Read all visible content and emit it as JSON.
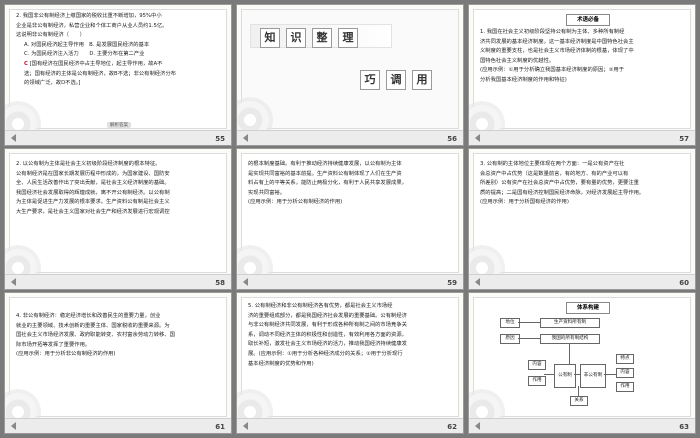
{
  "slides": [
    {
      "number": "55",
      "lines": [
        "2. 我国非公有制经济上缴国家的税收比重不断增加，95%中小",
        "企业是非公有制经济，私营企业和个体工商户从业人员约1.5亿。",
        "这说明非公有制经济（　　）",
        "A. 对国民经济起主导作用　B. 是发展国民经济的基本",
        "C. 为国民经济注入活力　　D. 主要分布在第二产业"
      ],
      "answer_letter": "C",
      "answer_lines": [
        "[国有经济在国民经济中占主导地位，起主导作用，故A不",
        "选；国有经济的主体是公有制经济，故B不选；非公有制经济分布",
        "的领域广泛，故D不选。]"
      ],
      "tag": "解析答案"
    },
    {
      "number": "56",
      "chars_top": [
        "知",
        "识",
        "整",
        "理"
      ],
      "chars_bottom": [
        "巧",
        "调",
        "用"
      ]
    },
    {
      "number": "57",
      "heading": "术语必备",
      "lines": [
        "1. 我国在社会主义初级阶段坚持公有制为主体、多种所有制经",
        "济共同发展的基本经济制度。这一基本经济制度是中国特色社会主",
        "义制度的重要支柱，也是社会主义市场经济体制的根基，体现了中",
        "国特色社会主义制度的优越性。",
        "(应用示例：①用于分析确立我国基本经济制度的原因；②用于",
        "分析我国基本经济制度的作用和特征)"
      ]
    },
    {
      "number": "58",
      "lines": [
        "2. 以公有制为主体是社会主义初级阶段经济制度的根本特征。",
        "公有制经济是在国家长期发展历程中形成的，为国家建设、国防安",
        "全、人民生活改善作出了突出贡献，是社会主义经济制度的基础。",
        "我国经济社会发展取得的辉煌成就，离不开公有制经济。以公有制",
        "为主体是促进生产力发展的根本要求。生产资料公有制是社会主义",
        "大生产要求，是社会主义国家对社会生产和经济发展进行宏观调控"
      ]
    },
    {
      "number": "59",
      "lines": [
        "的根本制度基础。有利于推动经济持续健康发展，以公有制为主体",
        "是实现共同富裕的基本前提。生产资料公有制体现了人们在生产资",
        "料占有上的平等关系，能防止两极分化，有利于人民共享发展成果，",
        "实现共同富裕。",
        "(应用示例：用于分析公有制经济的作用)"
      ]
    },
    {
      "number": "60",
      "lines": [
        "3. 公有制的主体地位主要体现在两个方面：一是公有资产在社",
        "会总资产中占优势（这是数量前言，有的地方、有的产业可以有",
        "所差别）公有资产在社会总资产中占优势，要有量的优势，更要注重",
        "质的提高；二是国有经济控制国民经济命脉，对经济发展起主导作用。",
        "(应用示例：用于分析国有经济的作用)"
      ]
    },
    {
      "number": "61",
      "lines": [
        "4. 非公有制经济：稳定经济增长和改善民生的重要力量，创业",
        "就业的主要领域、技术创新的重要主体、国家税收的重要来源。为",
        "国社会主义市场经济发展、政府职能转变、农村富余劳动力转移、国",
        "际市场开拓等发挥了重要作用。",
        "(应用示例：用于分析非公有制经济的作用)"
      ]
    },
    {
      "number": "62",
      "lines": [
        "5. 公有制经济和非公有制经济各有优势，都是社会主义市场经",
        "济的重要组成部分，都是我国经济社会发展的重要基础。公有制经济",
        "与非公有制经济共同发展，有利于形成各种所有制之间的市场竞争关",
        "系，调动不同经济主体的积极性和创造性，有效利用各方面的资源，",
        "取长补短，激发社会主义市场经济的活力，推动我国经济持续健康发",
        "展。(应用示例：①用于分析各种经济成分的关系；②用于分析现行",
        "基本经济制度的优势和作用)"
      ]
    },
    {
      "number": "63",
      "heading": "体系构建",
      "nodes": {
        "top1": "生产资料所有制",
        "top2": "我国的所有制结构",
        "left1": "地位",
        "left2": "原因",
        "mid1": "内容",
        "mid2": "作用",
        "c1": "公有制",
        "c2": "非公有制",
        "right1": "特点",
        "right2": "内容",
        "right3": "作用",
        "bottom": "关系"
      }
    }
  ]
}
